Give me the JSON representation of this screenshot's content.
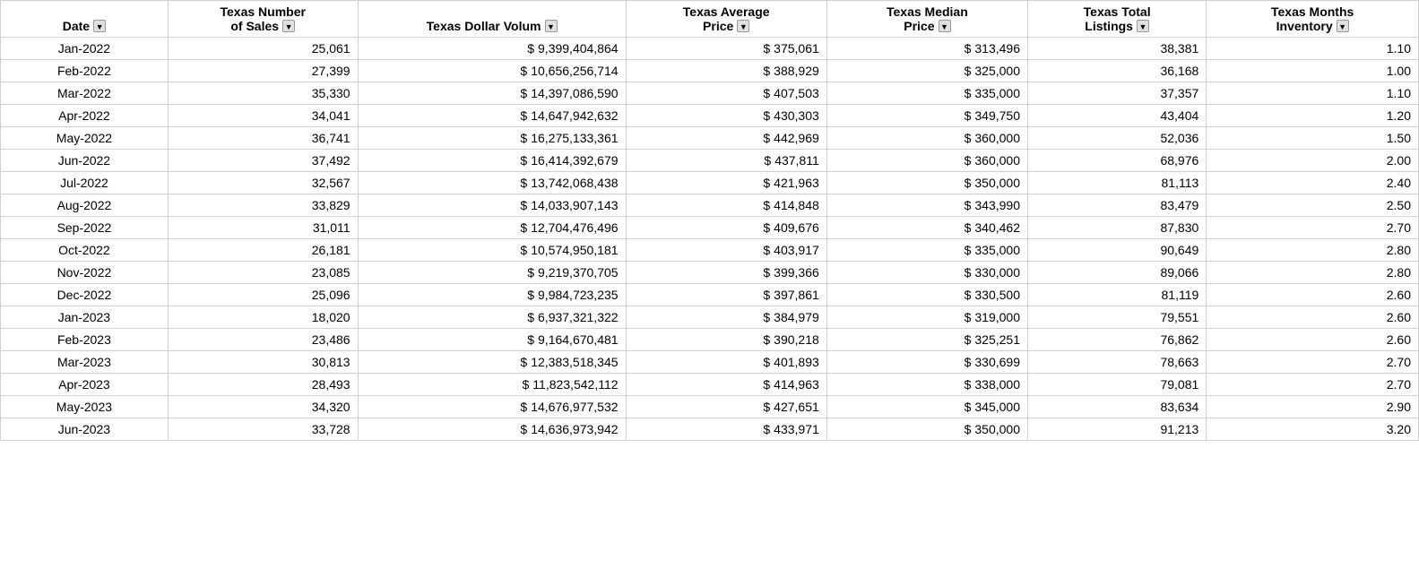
{
  "headers": {
    "date": {
      "top": "",
      "bottom": "Date",
      "has_filter": true
    },
    "number_of_sales": {
      "top": "Texas Number",
      "bottom": "of Sales",
      "has_dropdown": true
    },
    "dollar_volume": {
      "top": "",
      "bottom": "Texas Dollar Volum",
      "has_dropdown": true
    },
    "avg_price": {
      "top": "Texas Average",
      "bottom": "Price",
      "has_dropdown": true
    },
    "median_price": {
      "top": "Texas Median",
      "bottom": "Price",
      "has_dropdown": true
    },
    "total_listings": {
      "top": "Texas Total",
      "bottom": "Listings",
      "has_dropdown": true
    },
    "months_inventory": {
      "top": "Texas Months",
      "bottom": "Inventory",
      "has_dropdown": true
    }
  },
  "rows": [
    {
      "date": "Jan-2022",
      "number": "25,061",
      "dollar": "9,399,404,864",
      "avg": "375,061",
      "median": "313,496",
      "listings": "38,381",
      "months": "1.10"
    },
    {
      "date": "Feb-2022",
      "number": "27,399",
      "dollar": "10,656,256,714",
      "avg": "388,929",
      "median": "325,000",
      "listings": "36,168",
      "months": "1.00"
    },
    {
      "date": "Mar-2022",
      "number": "35,330",
      "dollar": "14,397,086,590",
      "avg": "407,503",
      "median": "335,000",
      "listings": "37,357",
      "months": "1.10"
    },
    {
      "date": "Apr-2022",
      "number": "34,041",
      "dollar": "14,647,942,632",
      "avg": "430,303",
      "median": "349,750",
      "listings": "43,404",
      "months": "1.20"
    },
    {
      "date": "May-2022",
      "number": "36,741",
      "dollar": "16,275,133,361",
      "avg": "442,969",
      "median": "360,000",
      "listings": "52,036",
      "months": "1.50"
    },
    {
      "date": "Jun-2022",
      "number": "37,492",
      "dollar": "16,414,392,679",
      "avg": "437,811",
      "median": "360,000",
      "listings": "68,976",
      "months": "2.00"
    },
    {
      "date": "Jul-2022",
      "number": "32,567",
      "dollar": "13,742,068,438",
      "avg": "421,963",
      "median": "350,000",
      "listings": "81,113",
      "months": "2.40"
    },
    {
      "date": "Aug-2022",
      "number": "33,829",
      "dollar": "14,033,907,143",
      "avg": "414,848",
      "median": "343,990",
      "listings": "83,479",
      "months": "2.50"
    },
    {
      "date": "Sep-2022",
      "number": "31,011",
      "dollar": "12,704,476,496",
      "avg": "409,676",
      "median": "340,462",
      "listings": "87,830",
      "months": "2.70"
    },
    {
      "date": "Oct-2022",
      "number": "26,181",
      "dollar": "10,574,950,181",
      "avg": "403,917",
      "median": "335,000",
      "listings": "90,649",
      "months": "2.80"
    },
    {
      "date": "Nov-2022",
      "number": "23,085",
      "dollar": "9,219,370,705",
      "avg": "399,366",
      "median": "330,000",
      "listings": "89,066",
      "months": "2.80"
    },
    {
      "date": "Dec-2022",
      "number": "25,096",
      "dollar": "9,984,723,235",
      "avg": "397,861",
      "median": "330,500",
      "listings": "81,119",
      "months": "2.60"
    },
    {
      "date": "Jan-2023",
      "number": "18,020",
      "dollar": "6,937,321,322",
      "avg": "384,979",
      "median": "319,000",
      "listings": "79,551",
      "months": "2.60"
    },
    {
      "date": "Feb-2023",
      "number": "23,486",
      "dollar": "9,164,670,481",
      "avg": "390,218",
      "median": "325,251",
      "listings": "76,862",
      "months": "2.60"
    },
    {
      "date": "Mar-2023",
      "number": "30,813",
      "dollar": "12,383,518,345",
      "avg": "401,893",
      "median": "330,699",
      "listings": "78,663",
      "months": "2.70"
    },
    {
      "date": "Apr-2023",
      "number": "28,493",
      "dollar": "11,823,542,112",
      "avg": "414,963",
      "median": "338,000",
      "listings": "79,081",
      "months": "2.70"
    },
    {
      "date": "May-2023",
      "number": "34,320",
      "dollar": "14,676,977,532",
      "avg": "427,651",
      "median": "345,000",
      "listings": "83,634",
      "months": "2.90"
    },
    {
      "date": "Jun-2023",
      "number": "33,728",
      "dollar": "14,636,973,942",
      "avg": "433,971",
      "median": "350,000",
      "listings": "91,213",
      "months": "3.20"
    }
  ]
}
